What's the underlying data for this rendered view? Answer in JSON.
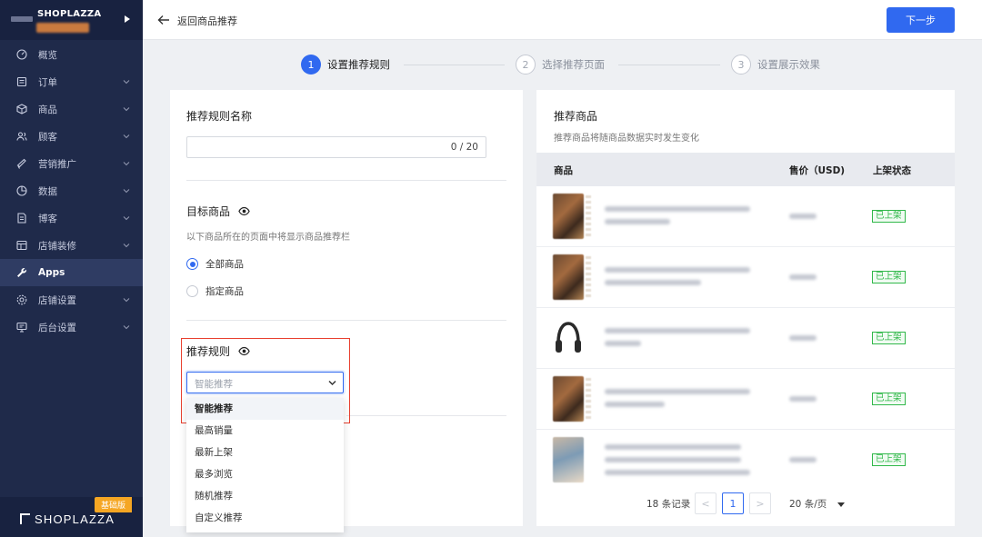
{
  "sidebar": {
    "shop_name": "SHOPLAZZA",
    "items": [
      {
        "label": "概览",
        "icon": "dashboard-icon",
        "has_chevron": false
      },
      {
        "label": "订单",
        "icon": "order-icon",
        "has_chevron": true
      },
      {
        "label": "商品",
        "icon": "product-box-icon",
        "has_chevron": true
      },
      {
        "label": "顾客",
        "icon": "customers-icon",
        "has_chevron": true
      },
      {
        "label": "营销推广",
        "icon": "marketing-icon",
        "has_chevron": true
      },
      {
        "label": "数据",
        "icon": "data-icon",
        "has_chevron": true
      },
      {
        "label": "博客",
        "icon": "blog-icon",
        "has_chevron": true
      },
      {
        "label": "店铺装修",
        "icon": "store-design-icon",
        "has_chevron": true
      },
      {
        "label": "Apps",
        "icon": "wrench-icon",
        "has_chevron": false,
        "active": true
      },
      {
        "label": "店铺设置",
        "icon": "settings-gear-icon",
        "has_chevron": true
      },
      {
        "label": "后台设置",
        "icon": "admin-monitor-icon",
        "has_chevron": true
      }
    ],
    "brand": "SHOPLAZZA",
    "plan_badge": "基础版"
  },
  "topbar": {
    "back_label": "返回商品推荐",
    "next_label": "下一步"
  },
  "steps": [
    {
      "num": "1",
      "label": "设置推荐规则",
      "active": true
    },
    {
      "num": "2",
      "label": "选择推荐页面",
      "active": false
    },
    {
      "num": "3",
      "label": "设置展示效果",
      "active": false
    }
  ],
  "left": {
    "rule_name_title": "推荐规则名称",
    "rule_name_value": "",
    "rule_name_counter": "0 / 20",
    "target_title": "目标商品",
    "target_hint": "以下商品所在的页面中将显示商品推荐栏",
    "target_options": [
      {
        "label": "全部商品",
        "checked": true
      },
      {
        "label": "指定商品",
        "checked": false
      }
    ],
    "rule_title": "推荐规则",
    "rule_placeholder": "智能推荐",
    "rule_options": [
      "智能推荐",
      "最高销量",
      "最新上架",
      "最多浏览",
      "随机推荐",
      "自定义推荐"
    ],
    "rule_selected": "智能推荐"
  },
  "right": {
    "title": "推荐商品",
    "hint": "推荐商品将随商品数据实时发生变化",
    "columns": [
      "商品",
      "售价（USD)",
      "上架状态"
    ],
    "rows": [
      {
        "status": "已上架"
      },
      {
        "status": "已上架"
      },
      {
        "status": "已上架"
      },
      {
        "status": "已上架"
      },
      {
        "status": "已上架"
      }
    ],
    "pagination": {
      "total": "18 条记录",
      "prev": "<",
      "current": "1",
      "next": ">",
      "page_size": "20 条/页"
    }
  },
  "colors": {
    "primary": "#3069f0",
    "sidebar_bg": "#1f2a4a",
    "success": "#31b84a",
    "highlight_border": "#e8402f",
    "plan_badge": "#f5a623"
  }
}
